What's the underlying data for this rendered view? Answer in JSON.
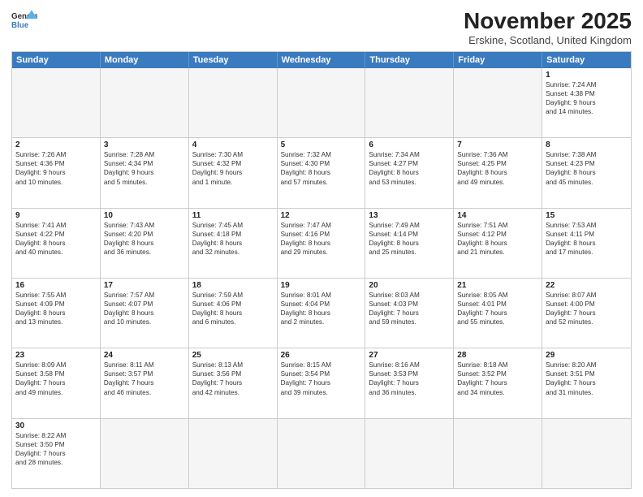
{
  "header": {
    "logo_general": "General",
    "logo_blue": "Blue",
    "title": "November 2025",
    "subtitle": "Erskine, Scotland, United Kingdom"
  },
  "days_of_week": [
    "Sunday",
    "Monday",
    "Tuesday",
    "Wednesday",
    "Thursday",
    "Friday",
    "Saturday"
  ],
  "weeks": [
    [
      {
        "day": "",
        "info": "",
        "empty": true
      },
      {
        "day": "",
        "info": "",
        "empty": true
      },
      {
        "day": "",
        "info": "",
        "empty": true
      },
      {
        "day": "",
        "info": "",
        "empty": true
      },
      {
        "day": "",
        "info": "",
        "empty": true
      },
      {
        "day": "",
        "info": "",
        "empty": true
      },
      {
        "day": "1",
        "info": "Sunrise: 7:24 AM\nSunset: 4:38 PM\nDaylight: 9 hours\nand 14 minutes.",
        "empty": false
      }
    ],
    [
      {
        "day": "2",
        "info": "Sunrise: 7:26 AM\nSunset: 4:36 PM\nDaylight: 9 hours\nand 10 minutes.",
        "empty": false
      },
      {
        "day": "3",
        "info": "Sunrise: 7:28 AM\nSunset: 4:34 PM\nDaylight: 9 hours\nand 5 minutes.",
        "empty": false
      },
      {
        "day": "4",
        "info": "Sunrise: 7:30 AM\nSunset: 4:32 PM\nDaylight: 9 hours\nand 1 minute.",
        "empty": false
      },
      {
        "day": "5",
        "info": "Sunrise: 7:32 AM\nSunset: 4:30 PM\nDaylight: 8 hours\nand 57 minutes.",
        "empty": false
      },
      {
        "day": "6",
        "info": "Sunrise: 7:34 AM\nSunset: 4:27 PM\nDaylight: 8 hours\nand 53 minutes.",
        "empty": false
      },
      {
        "day": "7",
        "info": "Sunrise: 7:36 AM\nSunset: 4:25 PM\nDaylight: 8 hours\nand 49 minutes.",
        "empty": false
      },
      {
        "day": "8",
        "info": "Sunrise: 7:38 AM\nSunset: 4:23 PM\nDaylight: 8 hours\nand 45 minutes.",
        "empty": false
      }
    ],
    [
      {
        "day": "9",
        "info": "Sunrise: 7:41 AM\nSunset: 4:22 PM\nDaylight: 8 hours\nand 40 minutes.",
        "empty": false
      },
      {
        "day": "10",
        "info": "Sunrise: 7:43 AM\nSunset: 4:20 PM\nDaylight: 8 hours\nand 36 minutes.",
        "empty": false
      },
      {
        "day": "11",
        "info": "Sunrise: 7:45 AM\nSunset: 4:18 PM\nDaylight: 8 hours\nand 32 minutes.",
        "empty": false
      },
      {
        "day": "12",
        "info": "Sunrise: 7:47 AM\nSunset: 4:16 PM\nDaylight: 8 hours\nand 29 minutes.",
        "empty": false
      },
      {
        "day": "13",
        "info": "Sunrise: 7:49 AM\nSunset: 4:14 PM\nDaylight: 8 hours\nand 25 minutes.",
        "empty": false
      },
      {
        "day": "14",
        "info": "Sunrise: 7:51 AM\nSunset: 4:12 PM\nDaylight: 8 hours\nand 21 minutes.",
        "empty": false
      },
      {
        "day": "15",
        "info": "Sunrise: 7:53 AM\nSunset: 4:11 PM\nDaylight: 8 hours\nand 17 minutes.",
        "empty": false
      }
    ],
    [
      {
        "day": "16",
        "info": "Sunrise: 7:55 AM\nSunset: 4:09 PM\nDaylight: 8 hours\nand 13 minutes.",
        "empty": false
      },
      {
        "day": "17",
        "info": "Sunrise: 7:57 AM\nSunset: 4:07 PM\nDaylight: 8 hours\nand 10 minutes.",
        "empty": false
      },
      {
        "day": "18",
        "info": "Sunrise: 7:59 AM\nSunset: 4:06 PM\nDaylight: 8 hours\nand 6 minutes.",
        "empty": false
      },
      {
        "day": "19",
        "info": "Sunrise: 8:01 AM\nSunset: 4:04 PM\nDaylight: 8 hours\nand 2 minutes.",
        "empty": false
      },
      {
        "day": "20",
        "info": "Sunrise: 8:03 AM\nSunset: 4:03 PM\nDaylight: 7 hours\nand 59 minutes.",
        "empty": false
      },
      {
        "day": "21",
        "info": "Sunrise: 8:05 AM\nSunset: 4:01 PM\nDaylight: 7 hours\nand 55 minutes.",
        "empty": false
      },
      {
        "day": "22",
        "info": "Sunrise: 8:07 AM\nSunset: 4:00 PM\nDaylight: 7 hours\nand 52 minutes.",
        "empty": false
      }
    ],
    [
      {
        "day": "23",
        "info": "Sunrise: 8:09 AM\nSunset: 3:58 PM\nDaylight: 7 hours\nand 49 minutes.",
        "empty": false
      },
      {
        "day": "24",
        "info": "Sunrise: 8:11 AM\nSunset: 3:57 PM\nDaylight: 7 hours\nand 46 minutes.",
        "empty": false
      },
      {
        "day": "25",
        "info": "Sunrise: 8:13 AM\nSunset: 3:56 PM\nDaylight: 7 hours\nand 42 minutes.",
        "empty": false
      },
      {
        "day": "26",
        "info": "Sunrise: 8:15 AM\nSunset: 3:54 PM\nDaylight: 7 hours\nand 39 minutes.",
        "empty": false
      },
      {
        "day": "27",
        "info": "Sunrise: 8:16 AM\nSunset: 3:53 PM\nDaylight: 7 hours\nand 36 minutes.",
        "empty": false
      },
      {
        "day": "28",
        "info": "Sunrise: 8:18 AM\nSunset: 3:52 PM\nDaylight: 7 hours\nand 34 minutes.",
        "empty": false
      },
      {
        "day": "29",
        "info": "Sunrise: 8:20 AM\nSunset: 3:51 PM\nDaylight: 7 hours\nand 31 minutes.",
        "empty": false
      }
    ],
    [
      {
        "day": "30",
        "info": "Sunrise: 8:22 AM\nSunset: 3:50 PM\nDaylight: 7 hours\nand 28 minutes.",
        "empty": false
      },
      {
        "day": "",
        "info": "",
        "empty": true
      },
      {
        "day": "",
        "info": "",
        "empty": true
      },
      {
        "day": "",
        "info": "",
        "empty": true
      },
      {
        "day": "",
        "info": "",
        "empty": true
      },
      {
        "day": "",
        "info": "",
        "empty": true
      },
      {
        "day": "",
        "info": "",
        "empty": true
      }
    ]
  ]
}
